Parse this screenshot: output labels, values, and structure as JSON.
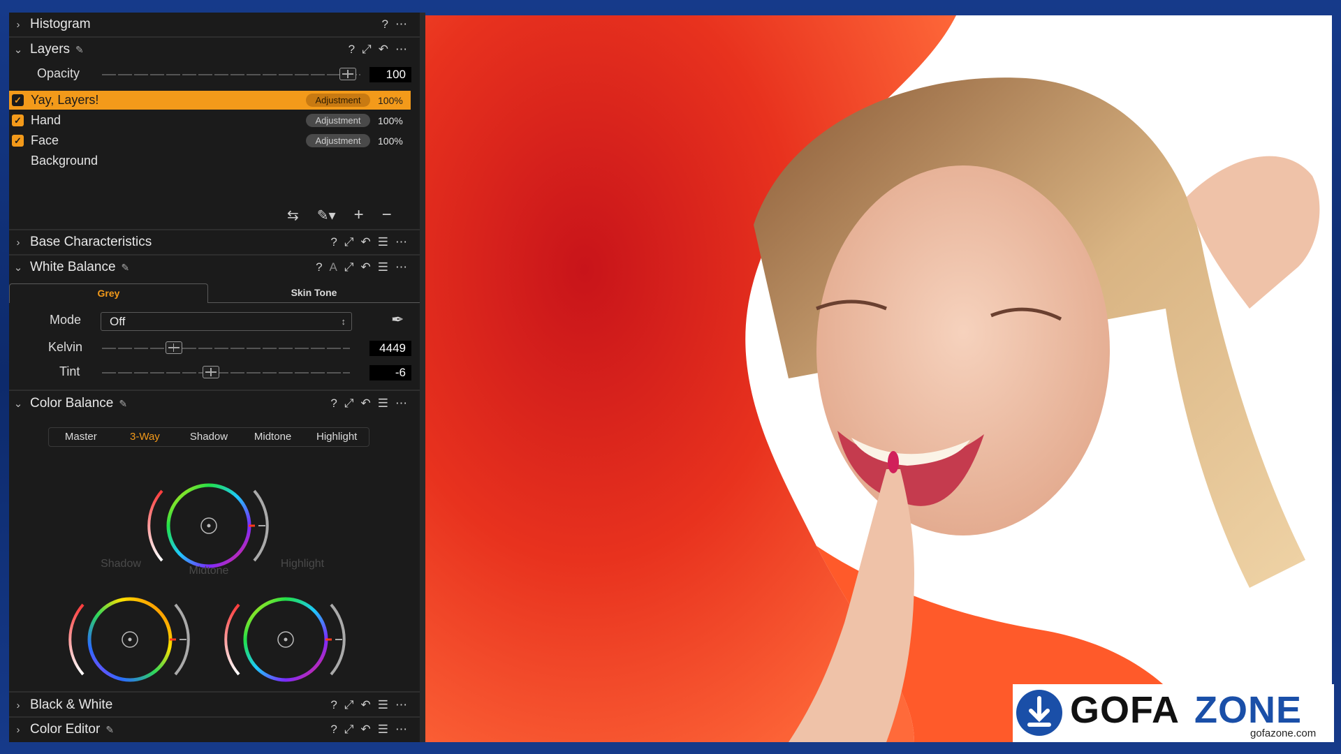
{
  "sections": {
    "histogram": {
      "title": "Histogram"
    },
    "layers": {
      "title": "Layers",
      "opacity_label": "Opacity",
      "opacity_value": "100",
      "items": [
        {
          "name": "Yay, Layers!",
          "badge": "Adjustment",
          "pct": "100%",
          "checked": true,
          "selected": true
        },
        {
          "name": "Hand",
          "badge": "Adjustment",
          "pct": "100%",
          "checked": true,
          "selected": false
        },
        {
          "name": "Face",
          "badge": "Adjustment",
          "pct": "100%",
          "checked": true,
          "selected": false
        },
        {
          "name": "Background",
          "badge": "",
          "pct": "",
          "checked": false,
          "selected": false
        }
      ]
    },
    "base": {
      "title": "Base Characteristics"
    },
    "wb": {
      "title": "White Balance",
      "tab_grey": "Grey",
      "tab_skin": "Skin Tone",
      "mode_label": "Mode",
      "mode_value": "Off",
      "kelvin_label": "Kelvin",
      "kelvin_value": "4449",
      "kelvin_level": 0.29,
      "tint_label": "Tint",
      "tint_value": "-6",
      "tint_level": 0.44
    },
    "cb": {
      "title": "Color Balance",
      "tabs": [
        "Master",
        "3-Way",
        "Shadow",
        "Midtone",
        "Highlight"
      ],
      "active_tab": "3-Way",
      "wheel_shadow": "Shadow",
      "wheel_midtone": "Midtone",
      "wheel_highlight": "Highlight"
    },
    "bw": {
      "title": "Black & White"
    },
    "ce": {
      "title": "Color Editor"
    }
  },
  "watermark": {
    "text1": "GOFA",
    "text2": "ZONE",
    "site": "gofazone.com"
  },
  "colors": {
    "accent": "#f39a1a",
    "panel": "#1b1b1b",
    "logo_blue": "#1a4fa8"
  }
}
